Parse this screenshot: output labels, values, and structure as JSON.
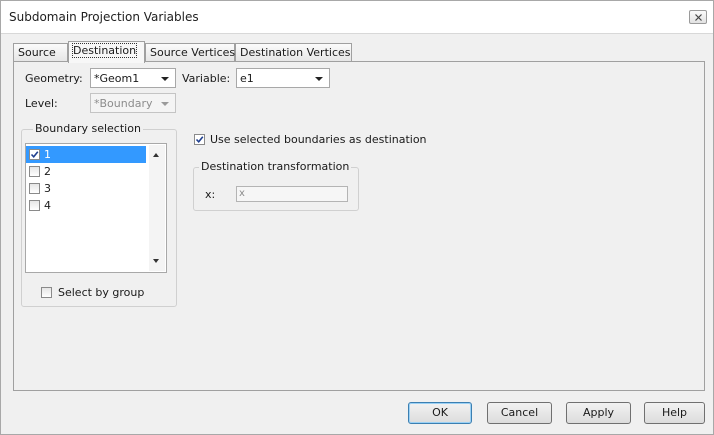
{
  "window": {
    "title": "Subdomain Projection Variables"
  },
  "tabs": [
    {
      "label": "Source",
      "active": false
    },
    {
      "label": "Destination",
      "active": true
    },
    {
      "label": "Source Vertices",
      "active": false
    },
    {
      "label": "Destination Vertices",
      "active": false
    }
  ],
  "form": {
    "geometry_label": "Geometry:",
    "geometry_value": "*Geom1",
    "variable_label": "Variable:",
    "variable_value": "e1",
    "level_label": "Level:",
    "level_value": "*Boundary"
  },
  "boundary_selection": {
    "legend": "Boundary selection",
    "items": [
      {
        "label": "1",
        "checked": true,
        "selected": true
      },
      {
        "label": "2",
        "checked": false,
        "selected": false
      },
      {
        "label": "3",
        "checked": false,
        "selected": false
      },
      {
        "label": "4",
        "checked": false,
        "selected": false
      }
    ],
    "select_by_group_label": "Select by group",
    "select_by_group_checked": false
  },
  "use_selected": {
    "label": "Use selected boundaries as destination",
    "checked": true
  },
  "destination_transformation": {
    "legend": "Destination transformation",
    "x_label": "x:",
    "x_value": "x"
  },
  "buttons": {
    "ok": "OK",
    "cancel": "Cancel",
    "apply": "Apply",
    "help": "Help"
  },
  "icons": {
    "close": "close-icon",
    "check": "checkmark-icon",
    "dropdown": "chevron-down-icon"
  },
  "colors": {
    "selection": "#3399ff",
    "dialog_bg": "#f0f0f0",
    "title_bg": "#ffffff"
  }
}
